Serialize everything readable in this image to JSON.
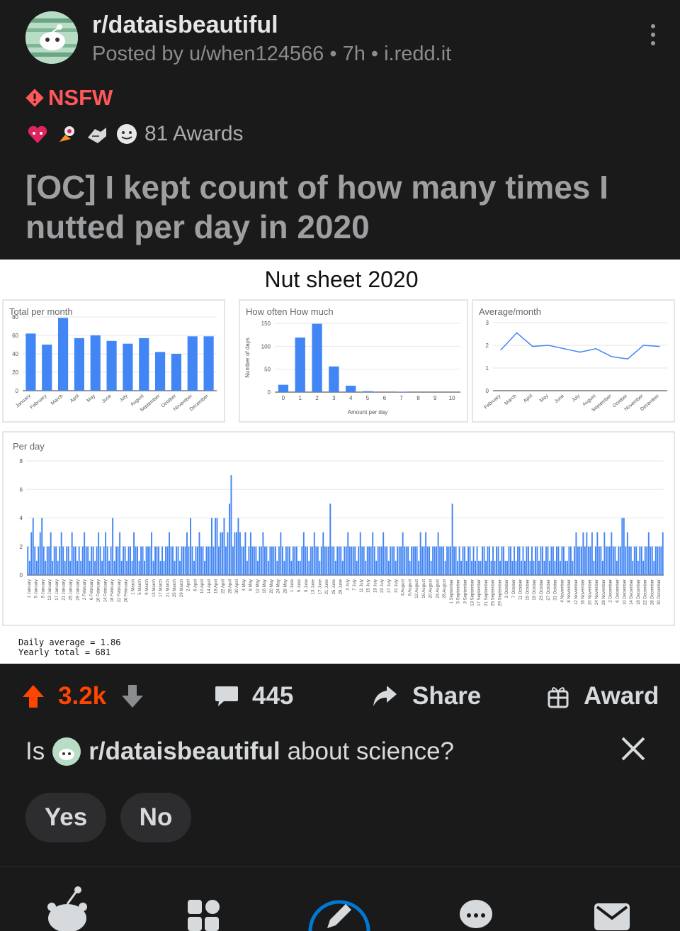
{
  "post": {
    "subreddit": "r/dataisbeautiful",
    "meta": "Posted by u/when124566 • 7h • i.redd.it",
    "nsfw": "NSFW",
    "awards": "81 Awards",
    "title": "[OC] I kept count of how many times I nutted per day in 2020"
  },
  "figure": {
    "title": "Nut sheet 2020",
    "daily_average": "Daily average = 1.86",
    "yearly_total": "Yearly total = 681"
  },
  "chart_data": [
    {
      "type": "bar",
      "title": "Total per month",
      "categories": [
        "January",
        "February",
        "March",
        "April",
        "May",
        "June",
        "July",
        "August",
        "September",
        "October",
        "November",
        "December"
      ],
      "values": [
        62,
        50,
        79,
        57,
        60,
        54,
        51,
        57,
        42,
        40,
        59,
        59
      ],
      "yticks": [
        "0",
        "20",
        "40",
        "60",
        "80"
      ],
      "ylim": [
        0,
        80
      ]
    },
    {
      "type": "bar",
      "title": "How often How much",
      "xlabel": "Amount per day",
      "ylabel": "Number of days",
      "categories": [
        "0",
        "1",
        "2",
        "3",
        "4",
        "5",
        "6",
        "7",
        "8",
        "9",
        "10"
      ],
      "values": [
        16,
        119,
        149,
        56,
        14,
        2,
        0,
        1,
        0,
        0,
        0
      ],
      "yticks": [
        "0",
        "50",
        "100",
        "150"
      ],
      "ylim": [
        0,
        150
      ]
    },
    {
      "type": "line",
      "title": "Average/month",
      "categories": [
        "February",
        "March",
        "April",
        "May",
        "June",
        "July",
        "August",
        "September",
        "October",
        "November",
        "December"
      ],
      "values": [
        1.8,
        2.55,
        1.95,
        2.0,
        1.85,
        1.7,
        1.85,
        1.5,
        1.4,
        2.0,
        1.95
      ],
      "yticks": [
        "0",
        "1",
        "2",
        "3"
      ],
      "ylim": [
        0,
        3
      ]
    },
    {
      "type": "bar",
      "title": "Per day",
      "yticks": [
        "0",
        "2",
        "4",
        "6",
        "8"
      ],
      "ylim": [
        0,
        8
      ],
      "x_labels": [
        "1 January",
        "5 January",
        "9 January",
        "13 January",
        "17 January",
        "21 January",
        "25 January",
        "29 January",
        "2 February",
        "6 February",
        "10 February",
        "14 February",
        "18 February",
        "22 February",
        "26 February",
        "1 March",
        "5 March",
        "9 March",
        "13 March",
        "17 March",
        "21 March",
        "25 March",
        "29 March",
        "2 April",
        "6 April",
        "10 April",
        "14 April",
        "18 April",
        "22 April",
        "26 April",
        "30 April",
        "4 May",
        "8 May",
        "12 May",
        "16 May",
        "20 May",
        "24 May",
        "28 May",
        "1 June",
        "5 June",
        "9 June",
        "13 June",
        "17 June",
        "21 June",
        "25 June",
        "29 June",
        "3 July",
        "7 July",
        "11 July",
        "15 July",
        "19 July",
        "23 July",
        "27 July",
        "31 July",
        "4 August",
        "8 August",
        "12 August",
        "16 August",
        "20 August",
        "24 August",
        "28 August",
        "1 September",
        "5 September",
        "9 September",
        "13 September",
        "17 September",
        "21 September",
        "25 September",
        "29 September",
        "3 October",
        "7 October",
        "11 October",
        "15 October",
        "19 October",
        "23 October",
        "27 October",
        "31 October",
        "4 November",
        "8 November",
        "12 November",
        "16 November",
        "20 November",
        "24 November",
        "28 November",
        "2 December",
        "6 December",
        "10 December",
        "14 December",
        "18 December",
        "22 December",
        "26 December",
        "30 December"
      ],
      "values": [
        2,
        1,
        3,
        4,
        2,
        1,
        2,
        3,
        4,
        2,
        1,
        2,
        2,
        3,
        1,
        2,
        2,
        1,
        2,
        3,
        2,
        1,
        2,
        2,
        1,
        3,
        2,
        2,
        1,
        2,
        1,
        2,
        3,
        2,
        2,
        1,
        2,
        2,
        1,
        2,
        3,
        2,
        1,
        2,
        3,
        2,
        1,
        2,
        4,
        1,
        2,
        2,
        3,
        1,
        2,
        2,
        1,
        2,
        2,
        1,
        3,
        2,
        2,
        1,
        2,
        2,
        1,
        2,
        2,
        2,
        3,
        1,
        2,
        2,
        2,
        1,
        2,
        1,
        2,
        2,
        3,
        2,
        2,
        1,
        2,
        2,
        1,
        2,
        2,
        2,
        3,
        2,
        4,
        2,
        1,
        2,
        2,
        3,
        2,
        2,
        1,
        2,
        2,
        2,
        4,
        2,
        4,
        4,
        2,
        3,
        3,
        4,
        2,
        3,
        5,
        7,
        2,
        3,
        3,
        4,
        3,
        2,
        2,
        3,
        1,
        2,
        3,
        2,
        2,
        2,
        1,
        2,
        2,
        3,
        2,
        2,
        1,
        2,
        2,
        2,
        2,
        1,
        2,
        3,
        2,
        1,
        2,
        2,
        2,
        1,
        2,
        2,
        2,
        1,
        1,
        2,
        3,
        2,
        2,
        1,
        2,
        2,
        3,
        2,
        2,
        1,
        2,
        3,
        2,
        2,
        2,
        5,
        2,
        2,
        1,
        2,
        2,
        2,
        1,
        2,
        2,
        3,
        2,
        2,
        2,
        2,
        1,
        2,
        3,
        2,
        2,
        1,
        2,
        2,
        2,
        3,
        2,
        1,
        2,
        2,
        2,
        3,
        2,
        2,
        1,
        2,
        2,
        2,
        1,
        2,
        2,
        2,
        3,
        2,
        2,
        2,
        1,
        2,
        2,
        2,
        2,
        1,
        3,
        2,
        2,
        3,
        2,
        2,
        1,
        2,
        2,
        2,
        3,
        2,
        2,
        2,
        1,
        2,
        2,
        2,
        5,
        2,
        2,
        1,
        2,
        1,
        2,
        2,
        1,
        2,
        2,
        1,
        2,
        1,
        2,
        1,
        1,
        2,
        2,
        1,
        2,
        2,
        1,
        2,
        1,
        2,
        2,
        1,
        2,
        2,
        1,
        1,
        2,
        2,
        1,
        2,
        1,
        2,
        2,
        1,
        2,
        1,
        2,
        2,
        1,
        2,
        1,
        2,
        2,
        1,
        2,
        2,
        1,
        2,
        2,
        1,
        2,
        2,
        1,
        2,
        2,
        1,
        2,
        2,
        1,
        1,
        2,
        2,
        1,
        2,
        3,
        2,
        2,
        2,
        3,
        2,
        3,
        2,
        2,
        3,
        1,
        2,
        3,
        2,
        2,
        1,
        3,
        2,
        2,
        2,
        3,
        2,
        2,
        1,
        2,
        2,
        4,
        4,
        2,
        3,
        2,
        2,
        1,
        2,
        2,
        1,
        2,
        2,
        1,
        2,
        2,
        3,
        2,
        2,
        1,
        2,
        2,
        2,
        2,
        3
      ]
    }
  ],
  "actions": {
    "upvotes": "3.2k",
    "comments": "445",
    "share": "Share",
    "award": "Award"
  },
  "survey": {
    "prefix": "Is",
    "subreddit": "r/dataisbeautiful",
    "suffix": "about science?",
    "yes": "Yes",
    "no": "No"
  }
}
